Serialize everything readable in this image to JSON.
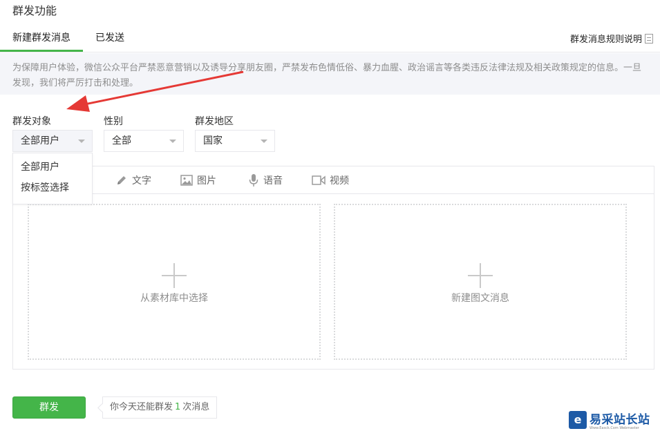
{
  "page": {
    "title": "群发功能"
  },
  "tabs": [
    {
      "label": "新建群发消息",
      "active": true
    },
    {
      "label": "已发送",
      "active": false
    }
  ],
  "rules_link": {
    "label": "群发消息规则说明",
    "icon": "document-icon"
  },
  "notice": {
    "text": "为保障用户体验，微信公众平台严禁恶意营销以及诱导分享朋友圈，严禁发布色情低俗、暴力血腥、政治谣言等各类违反法律法规及相关政策规定的信息。一旦发现，我们将严厉打击和处理。"
  },
  "filters": {
    "target": {
      "label": "群发对象",
      "value": "全部用户",
      "options": [
        "全部用户",
        "按标签选择"
      ],
      "open": true
    },
    "gender": {
      "label": "性别",
      "value": "全部"
    },
    "region": {
      "label": "群发地区",
      "value": "国家"
    }
  },
  "editor": {
    "tools": [
      {
        "label": "文字",
        "icon": "pencil-icon"
      },
      {
        "label": "图片",
        "icon": "image-icon"
      },
      {
        "label": "语音",
        "icon": "microphone-icon"
      },
      {
        "label": "视频",
        "icon": "video-icon"
      }
    ],
    "zones": [
      {
        "label": "从素材库中选择",
        "icon": "plus-icon"
      },
      {
        "label": "新建图文消息",
        "icon": "plus-icon"
      }
    ]
  },
  "footer": {
    "send_label": "群发",
    "quota_before": "你今天还能群发",
    "quota_count": "1",
    "quota_after": "次消息"
  },
  "watermark": {
    "logo": "e",
    "text": "易采站长站",
    "sub": "Www.Easck.Com Webmaster"
  },
  "colors": {
    "accent": "#44b549",
    "annotation_arrow": "#e53935",
    "watermark_blue": "#1d5aa6"
  }
}
